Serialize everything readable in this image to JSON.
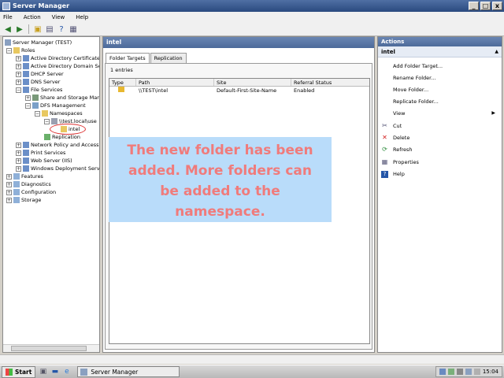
{
  "window": {
    "title": "Server Manager",
    "controls": [
      "_",
      "□",
      "x"
    ]
  },
  "menu": [
    "File",
    "Action",
    "View",
    "Help"
  ],
  "toolbar_icons": [
    "back-icon",
    "forward-icon",
    "up-icon",
    "show-hide-tree-icon",
    "help-icon",
    "properties-icon"
  ],
  "tree": [
    {
      "label": "Server Manager (TEST)",
      "icon": "server-icon"
    },
    {
      "label": "Roles",
      "icon": "folder-icon"
    },
    {
      "label": "Active Directory Certificate",
      "icon": "role-icon"
    },
    {
      "label": "Active Directory Domain Se",
      "icon": "role-icon"
    },
    {
      "label": "DHCP Server",
      "icon": "role-icon"
    },
    {
      "label": "DNS Server",
      "icon": "role-icon"
    },
    {
      "label": "File Services",
      "icon": "role-icon"
    },
    {
      "label": "Share and Storage Mar",
      "icon": "share-icon"
    },
    {
      "label": "DFS Management",
      "icon": "dfs-icon"
    },
    {
      "label": "Namespaces",
      "icon": "folder-icon"
    },
    {
      "label": "\\\\test.local\\use",
      "icon": "namespace-icon"
    },
    {
      "label": "intel",
      "icon": "folder-icon"
    },
    {
      "label": "Replication",
      "icon": "replication-icon"
    },
    {
      "label": "Network Policy and Access",
      "icon": "role-icon"
    },
    {
      "label": "Print Services",
      "icon": "role-icon"
    },
    {
      "label": "Web Server (IIS)",
      "icon": "role-icon"
    },
    {
      "label": "Windows Deployment Serv",
      "icon": "role-icon"
    },
    {
      "label": "Features",
      "icon": "features-icon"
    },
    {
      "label": "Diagnostics",
      "icon": "diagnostics-icon"
    },
    {
      "label": "Configuration",
      "icon": "configuration-icon"
    },
    {
      "label": "Storage",
      "icon": "storage-icon"
    }
  ],
  "center": {
    "title": "intel",
    "tabs": [
      "Folder Targets",
      "Replication"
    ],
    "entries": "1 entries",
    "columns": [
      "Type",
      "Path",
      "Site",
      "Referral Status"
    ],
    "rows": [
      {
        "path": "\\\\TEST\\intel",
        "site": "Default-First-Site-Name",
        "status": "Enabled"
      }
    ]
  },
  "callout": {
    "line1": "The new folder has been",
    "line2": "added. More folders can",
    "line3": "be added to the",
    "line4": "namespace."
  },
  "actions": {
    "header": "Actions",
    "subheader": "intel",
    "items": [
      {
        "label": "Add Folder Target...",
        "icon": ""
      },
      {
        "label": "Rename Folder...",
        "icon": ""
      },
      {
        "label": "Move Folder...",
        "icon": ""
      },
      {
        "label": "Replicate Folder...",
        "icon": ""
      },
      {
        "label": "View",
        "icon": ""
      },
      {
        "label": "Cut",
        "icon": "cut-icon"
      },
      {
        "label": "Delete",
        "icon": "delete-icon"
      },
      {
        "label": "Refresh",
        "icon": "refresh-icon"
      },
      {
        "label": "Properties",
        "icon": "properties-icon"
      },
      {
        "label": "Help",
        "icon": "help-icon"
      }
    ]
  },
  "taskbar": {
    "start": "Start",
    "task": "Server Manager",
    "clock": "15:04"
  },
  "colors": {
    "accent": "#4c6a9a",
    "callout_bg": "#b9dcfa",
    "callout_text": "#f07b7b",
    "delete": "#d32020"
  }
}
